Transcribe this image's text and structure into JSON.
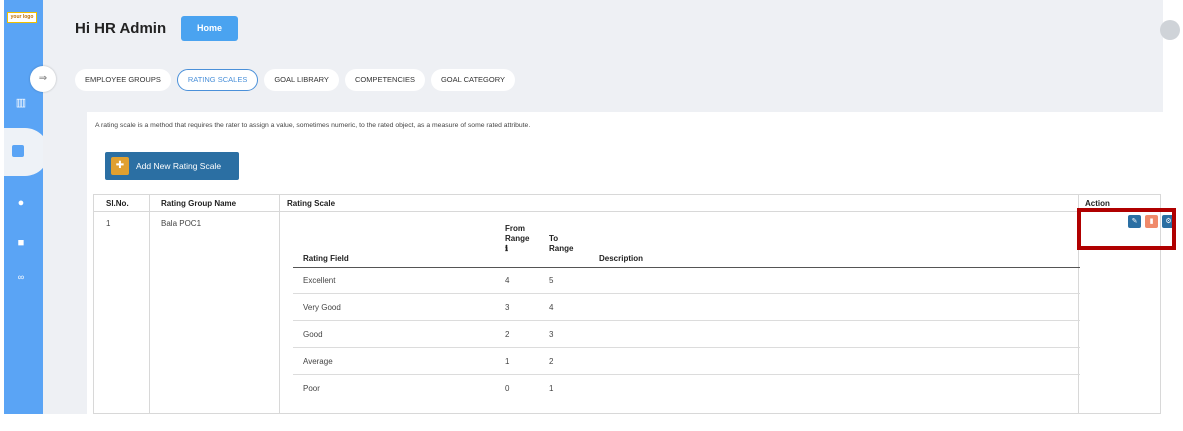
{
  "sidebar": {
    "logo_text": "your logo",
    "icons": [
      "dashboard-icon",
      "grid-icon",
      "users-icon",
      "box-icon",
      "link-icon"
    ]
  },
  "header": {
    "greeting": "Hi HR Admin",
    "home_label": "Home"
  },
  "tabs": [
    {
      "label": "EMPLOYEE GROUPS",
      "active": false
    },
    {
      "label": "RATING SCALES",
      "active": true
    },
    {
      "label": "GOAL LIBRARY",
      "active": false
    },
    {
      "label": "COMPETENCIES",
      "active": false
    },
    {
      "label": "GOAL CATEGORY",
      "active": false
    }
  ],
  "description": "A rating scale is a method that requires the rater to assign a value, sometimes numeric, to the rated object, as a measure of some rated attribute.",
  "add_button_label": "Add New Rating Scale",
  "table": {
    "headers": {
      "sl_no": "Sl.No.",
      "group_name": "Rating Group Name",
      "rating_scale": "Rating Scale",
      "action": "Action"
    },
    "row": {
      "sl_no": "1",
      "group_name": "Bala POC1"
    },
    "inner_headers": {
      "rating_field": "Rating Field",
      "from_range_line1": "From",
      "from_range_line2": "Range",
      "info_icon": "ℹ",
      "to_range_line1": "To",
      "to_range_line2": "Range",
      "description": "Description"
    },
    "inner_rows": [
      {
        "field": "Excellent",
        "from": "4",
        "to": "5"
      },
      {
        "field": "Very Good",
        "from": "3",
        "to": "4"
      },
      {
        "field": "Good",
        "from": "2",
        "to": "3"
      },
      {
        "field": "Average",
        "from": "1",
        "to": "2"
      },
      {
        "field": "Poor",
        "from": "0",
        "to": "1"
      }
    ]
  },
  "colors": {
    "sidebar": "#5aa4f5",
    "primary_button": "#2b6fa3",
    "delete_button": "#f08a6a",
    "highlight_border": "#b00000"
  }
}
